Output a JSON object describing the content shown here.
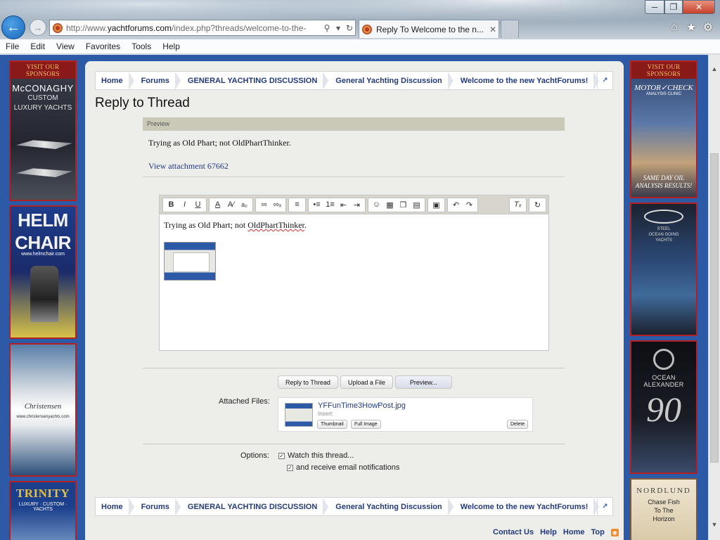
{
  "browser": {
    "url_prefix": "http://www.",
    "url_domain": "yachtforums.com",
    "url_path": "/index.php?threads/welcome-to-the-",
    "tab_title": "Reply To Welcome to the n...",
    "menu": [
      "File",
      "Edit",
      "View",
      "Favorites",
      "Tools",
      "Help"
    ]
  },
  "ads_left": {
    "header": "VISIT OUR SPONSORS",
    "mcconaghy": {
      "brand": "McCONAGHY",
      "line1": "CUSTOM",
      "line2": "LUXURY YACHTS"
    },
    "helm": {
      "line1": "HELM",
      "line2": "CHAIR",
      "url": "www.helmchair.com"
    },
    "christensen": {
      "brand": "Christensen",
      "url": "www.christensenyachts.com"
    },
    "trinity": {
      "brand": "TRINITY",
      "tagline": "LUXURY · CUSTOM · YACHTS"
    }
  },
  "ads_right": {
    "header": "VISIT OUR SPONSORS",
    "motorcheck": {
      "brand": "MOTOR✓CHECK",
      "sub": "ANALYSIS CLINIC",
      "tag1": "SAME DAY OIL",
      "tag2": "ANALYSIS RESULTS!"
    },
    "bering": {
      "line1": "STEEL",
      "line2": "OCEAN GOING",
      "line3": "YACHTS"
    },
    "oceanalex": {
      "brand": "OCEAN ALEXANDER",
      "number": "90"
    },
    "nordlund": {
      "brand": "NORDLUND",
      "line1": "Chase Fish",
      "line2": "To The",
      "line3": "Horizon"
    }
  },
  "breadcrumb": [
    "Home",
    "Forums",
    "GENERAL YACHTING DISCUSSION",
    "General Yachting Discussion",
    "Welcome to the new YachtForums!"
  ],
  "page_title": "Reply to Thread",
  "preview": {
    "header": "Preview",
    "text": "Trying as Old Phart; not OldPhartThinker.",
    "attachment_link": "View attachment 67662"
  },
  "editor": {
    "text_before": "Trying as Old Phart; not ",
    "text_misspelled": "OldPhartThinker",
    "text_after": "."
  },
  "buttons": {
    "reply": "Reply to Thread",
    "upload": "Upload a File",
    "preview": "Preview..."
  },
  "attachments": {
    "label": "Attached Files:",
    "filename": "YFFunTime3HowPost.jpg",
    "insert_label": "Insert:",
    "thumbnail_btn": "Thumbnail",
    "fullimage_btn": "Full Image",
    "delete_btn": "Delete"
  },
  "options": {
    "label": "Options:",
    "watch": "Watch this thread...",
    "email": "and receive email notifications"
  },
  "footer": [
    "Contact Us",
    "Help",
    "Home",
    "Top"
  ],
  "colors": {
    "page_bg": "#2d5aa6",
    "panel_bg": "#ededea",
    "link": "#223a7a",
    "ad_border": "#b22020"
  }
}
